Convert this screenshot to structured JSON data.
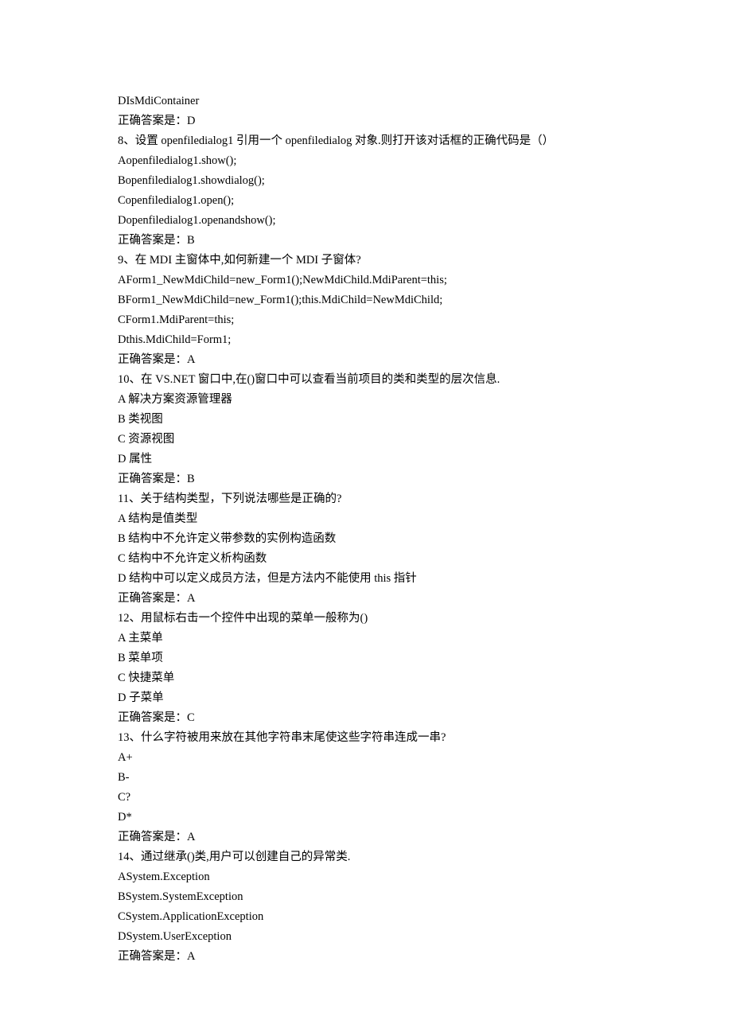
{
  "lines": [
    "DIsMdiContainer",
    "正确答案是：D",
    "8、设置 openfiledialog1 引用一个 openfiledialog 对象.则打开该对话框的正确代码是（）",
    "Aopenfiledialog1.show();",
    "Bopenfiledialog1.showdialog();",
    "Copenfiledialog1.open();",
    "Dopenfiledialog1.openandshow();",
    "正确答案是：B",
    "9、在 MDI 主窗体中,如何新建一个 MDI 子窗体?",
    "AForm1_NewMdiChild=new_Form1();NewMdiChild.MdiParent=this;",
    "BForm1_NewMdiChild=new_Form1();this.MdiChild=NewMdiChild;",
    "CForm1.MdiParent=this;",
    "Dthis.MdiChild=Form1;",
    "正确答案是：A",
    "10、在 VS.NET 窗口中,在()窗口中可以查看当前项目的类和类型的层次信息.",
    "A 解决方案资源管理器",
    "B 类视图",
    "C 资源视图",
    "D 属性",
    "正确答案是：B",
    "11、关于结构类型，下列说法哪些是正确的?",
    "A 结构是值类型",
    "B 结构中不允许定义带参数的实例构造函数",
    "C 结构中不允许定义析构函数",
    "D 结构中可以定义成员方法，但是方法内不能使用 this 指针",
    "正确答案是：A",
    "12、用鼠标右击一个控件中出现的菜单一般称为()",
    "A 主菜单",
    "B 菜单项",
    "C 快捷菜单",
    "D 子菜单",
    "正确答案是：C",
    "13、什么字符被用来放在其他字符串末尾使这些字符串连成一串?",
    "A+",
    "B-",
    "C?",
    "D*",
    "正确答案是：A",
    "14、通过继承()类,用户可以创建自己的异常类.",
    "ASystem.Exception",
    "BSystem.SystemException",
    "CSystem.ApplicationException",
    "DSystem.UserException",
    "正确答案是：A"
  ]
}
